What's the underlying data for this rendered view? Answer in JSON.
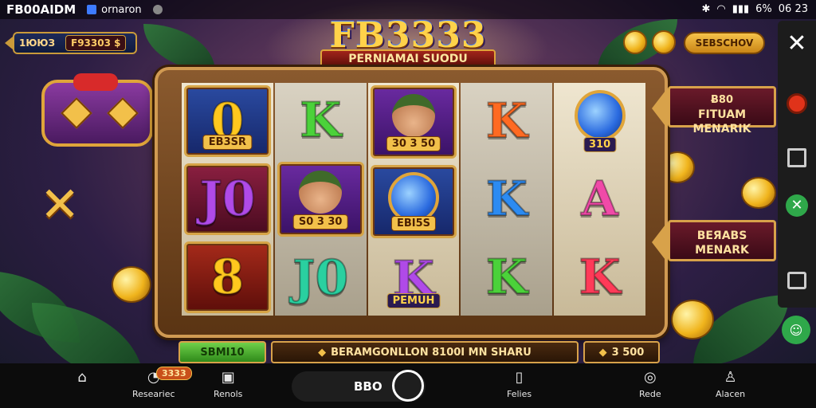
{
  "status_bar": {
    "app_name": "FB00AIDM",
    "operator": "ornaron",
    "battery": "6%",
    "time": "06 23",
    "icons": [
      "bluetooth-icon",
      "wifi-icon",
      "signal-icon"
    ]
  },
  "header": {
    "balance_label": "1ЮЮЗ",
    "balance_value": "F93303 $",
    "logo_title": "FB3333",
    "logo_subtitle": "PERNIAMAI SUODU",
    "right_pill": "SEBSCHOV"
  },
  "reels": [
    {
      "cells": [
        {
          "symbol": "0",
          "color": "gold",
          "tag": "EB3SR",
          "frame": "bg-blue"
        },
        {
          "symbol": "J0",
          "color": "purple",
          "tag": "",
          "frame": "bg-wine"
        },
        {
          "symbol": "8",
          "color": "gold",
          "tag": "",
          "frame": "bg-red"
        }
      ]
    },
    {
      "cells": [
        {
          "symbol": "K",
          "color": "green",
          "tag": "",
          "frame": ""
        },
        {
          "symbol": "",
          "color": "",
          "tag": "S0 3 30",
          "frame": "bg-purple",
          "face": true
        },
        {
          "symbol": "J0",
          "color": "teal",
          "tag": "",
          "frame": ""
        }
      ]
    },
    {
      "cells": [
        {
          "symbol": "",
          "color": "",
          "tag": "30 3 50",
          "frame": "bg-purple",
          "face": true
        },
        {
          "symbol": "",
          "color": "",
          "tag": "EBI5S",
          "frame": "bg-blue",
          "wild": true
        },
        {
          "symbol": "K",
          "color": "purple",
          "tag": "PEMUH",
          "frame": ""
        }
      ]
    },
    {
      "cells": [
        {
          "symbol": "K",
          "color": "orange",
          "tag": "",
          "frame": ""
        },
        {
          "symbol": "K",
          "color": "blue",
          "tag": "",
          "frame": ""
        },
        {
          "symbol": "K",
          "color": "green",
          "tag": "",
          "frame": ""
        }
      ]
    },
    {
      "cells": [
        {
          "symbol": "",
          "color": "",
          "tag": "310",
          "frame": "",
          "wild": true
        },
        {
          "symbol": "A",
          "color": "pink",
          "tag": "",
          "frame": ""
        },
        {
          "symbol": "K",
          "color": "red-k",
          "tag": "",
          "frame": ""
        }
      ]
    }
  ],
  "banners": {
    "top": {
      "line1": "Ƀ80",
      "line2": "FITUAM",
      "line3": "MENARIK"
    },
    "bottom": {
      "line1": "BEЯABS",
      "line2": "MENARK"
    }
  },
  "info_bar": {
    "bet_label": "SBMI10",
    "message": "BERAMGONLLON  8100I MN  SHARU",
    "win": "3 500"
  },
  "bottom_nav": {
    "items": [
      {
        "label": "",
        "icon": "home-icon"
      },
      {
        "label": "Researiec",
        "icon": "clock-icon"
      },
      {
        "label": "Renols",
        "icon": "refresh-icon"
      },
      {
        "label": "Felies",
        "icon": "phone-icon"
      },
      {
        "label": "Rede",
        "icon": "compass-icon"
      },
      {
        "label": "Alacen",
        "icon": "user-icon"
      }
    ],
    "badge": "3333",
    "home_text": "BBO"
  },
  "colors": {
    "gold": "#ffc81e",
    "frame_wood": "#8a5a2e",
    "banner_red": "#6a1a2a"
  }
}
